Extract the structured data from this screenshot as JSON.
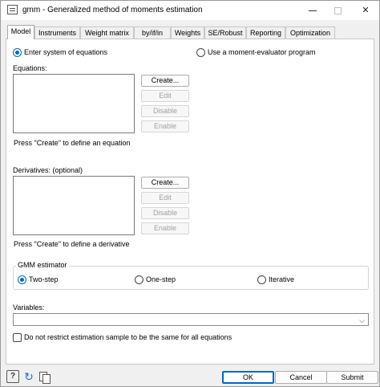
{
  "window": {
    "title": "gmm - Generalized method of moments estimation"
  },
  "tabs": [
    "Model",
    "Instruments",
    "Weight matrix",
    "by/if/in",
    "Weights",
    "SE/Robust",
    "Reporting",
    "Optimization"
  ],
  "model": {
    "spec_options": [
      {
        "label": "Enter system of equations",
        "selected": true
      },
      {
        "label": "Use a moment-evaluator program",
        "selected": false
      }
    ],
    "equations": {
      "label": "Equations:",
      "buttons": [
        "Create...",
        "Edit",
        "Disable",
        "Enable"
      ],
      "hint": "Press \"Create\" to define an equation"
    },
    "derivatives": {
      "label": "Derivatives: (optional)",
      "buttons": [
        "Create...",
        "Edit",
        "Disable",
        "Enable"
      ],
      "hint": "Press \"Create\" to define a derivative"
    },
    "estimator": {
      "title": "GMM estimator",
      "options": [
        {
          "label": "Two-step",
          "selected": true
        },
        {
          "label": "One-step",
          "selected": false
        },
        {
          "label": "Iterative",
          "selected": false
        }
      ]
    },
    "variables": {
      "label": "Variables:",
      "value": ""
    },
    "restrict_sample": {
      "label": "Do not restrict estimation sample to be the same for all equations",
      "checked": false
    }
  },
  "footer": {
    "icons": [
      "help-icon",
      "reset-icon",
      "copy-icon"
    ],
    "buttons": {
      "ok": "OK",
      "cancel": "Cancel",
      "submit": "Submit"
    }
  }
}
